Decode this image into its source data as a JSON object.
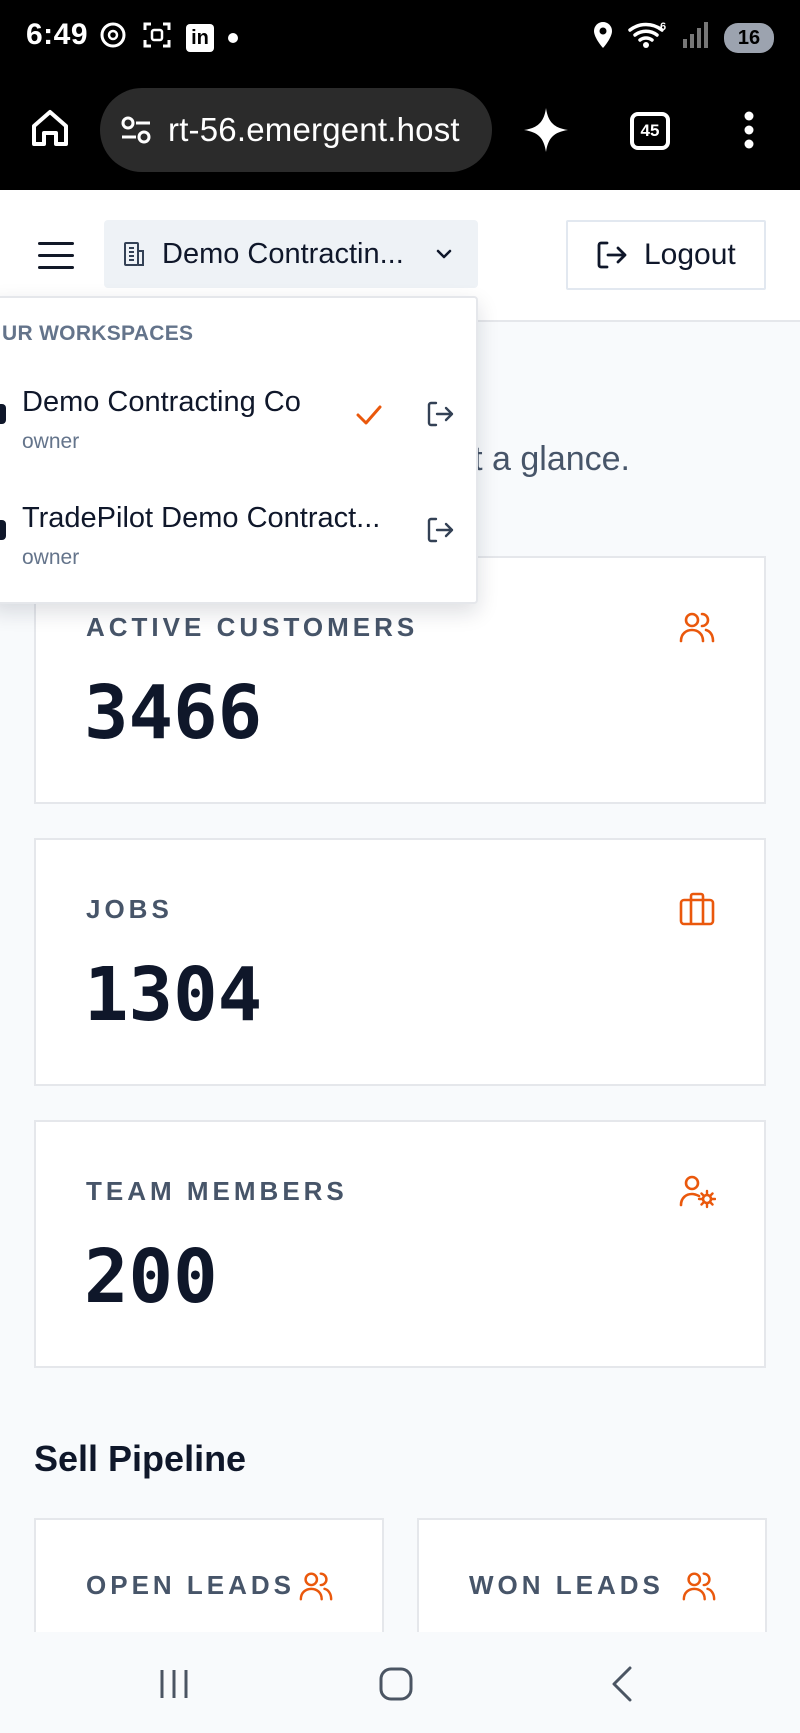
{
  "status_bar": {
    "time": "6:49",
    "battery": "16",
    "network_gen": "6"
  },
  "browser": {
    "url": "rt-56.emergent.host",
    "tab_count": "45"
  },
  "header": {
    "workspace_label": "Demo Contractin...",
    "logout_label": "Logout"
  },
  "page": {
    "subtitle_fragment": "t a glance."
  },
  "stats": [
    {
      "label": "ACTIVE CUSTOMERS",
      "value": "3466",
      "icon": "users-icon"
    },
    {
      "label": "JOBS",
      "value": "1304",
      "icon": "briefcase-icon"
    },
    {
      "label": "TEAM MEMBERS",
      "value": "200",
      "icon": "user-cog-icon"
    }
  ],
  "pipeline": {
    "title": "Sell Pipeline",
    "cards": [
      {
        "label": "OPEN LEADS",
        "icon": "users-icon"
      },
      {
        "label": "WON LEADS",
        "icon": "users-icon"
      }
    ]
  },
  "workspace_menu": {
    "heading": "UR WORKSPACES",
    "items": [
      {
        "name": "Demo Contracting Co",
        "role": "owner",
        "selected": true
      },
      {
        "name": "TradePilot Demo Contract...",
        "role": "owner",
        "selected": false
      }
    ]
  },
  "colors": {
    "accent": "#ea580c",
    "text": "#0f172a",
    "muted": "#475569"
  }
}
